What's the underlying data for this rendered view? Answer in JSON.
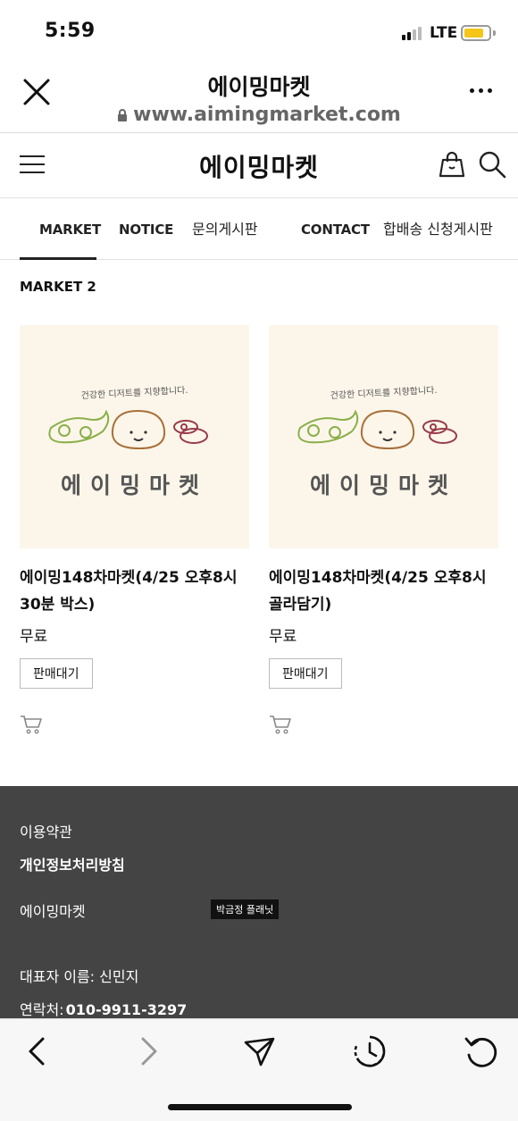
{
  "status": {
    "time": "5:59",
    "network": "LTE",
    "battery_level": 0.8
  },
  "browser": {
    "title": "에이밍마켓",
    "url": "www.aimingmarket.com"
  },
  "site": {
    "logo": "에이밍마켓"
  },
  "nav": {
    "tabs": [
      "MARKET",
      "NOTICE",
      "문의게시판",
      "CONTACT",
      "합배송 신청게시판"
    ],
    "active_tab": "MARKET"
  },
  "section": {
    "title": "MARKET 2"
  },
  "products": [
    {
      "title_line1": "에이밍148차마켓(4/25 오후8시",
      "title_line2": "30분 박스)",
      "price": "무료",
      "badge": "판매대기",
      "image_tagline": "건강한 디저트를 지향합니다.",
      "image_brand": "에이밍마켓"
    },
    {
      "title_line1": "에이밍148차마켓(4/25 오후8시",
      "title_line2": "골라담기)",
      "price": "무료",
      "badge": "판매대기",
      "image_tagline": "건강한 디저트를 지향합니다.",
      "image_brand": "에이밍마켓"
    }
  ],
  "footer": {
    "terms": "이용약관",
    "privacy": "개인정보처리방침",
    "company": "에이밍마켓",
    "chip": "박금정 플래닛",
    "ceo": "대표자 이름: 신민지",
    "contact_label": "연락처:",
    "contact_value": "010-9911-3297"
  },
  "icons": [
    "close-icon",
    "lock-icon",
    "more-icon",
    "menu-icon",
    "shopping-bag-icon",
    "search-icon",
    "cart-icon",
    "back-icon",
    "forward-icon",
    "share-icon",
    "history-icon",
    "reload-icon"
  ],
  "colors": {
    "thumb_bg": "#fcf6ea",
    "footer_bg": "#444444",
    "battery": "#f5c518"
  }
}
